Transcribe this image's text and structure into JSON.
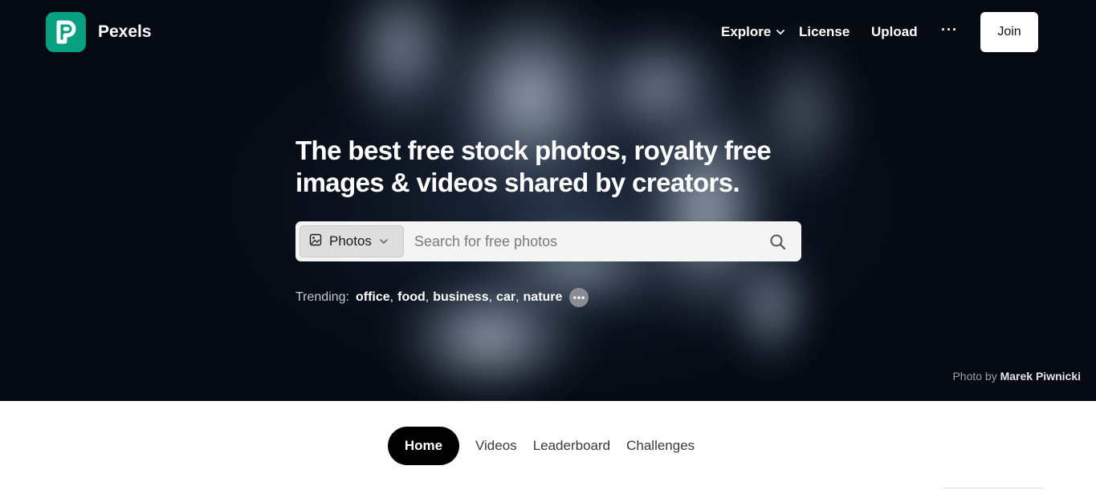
{
  "brand": {
    "name": "Pexels",
    "logo_color": "#07a081"
  },
  "nav": {
    "explore": "Explore",
    "license": "License",
    "upload": "Upload",
    "more": "···",
    "join": "Join"
  },
  "hero": {
    "headline_line1": "The best free stock photos, royalty free",
    "headline_line2": "images & videos shared by creators.",
    "search": {
      "type_label": "Photos",
      "placeholder": "Search for free photos"
    },
    "trending": {
      "label": "Trending:",
      "items": [
        "office",
        "food",
        "business",
        "car",
        "nature"
      ],
      "more": "•••"
    },
    "credit": {
      "prefix": "Photo by",
      "author": "Marek Piwnicki"
    }
  },
  "tabs": [
    "Home",
    "Videos",
    "Leaderboard",
    "Challenges"
  ],
  "active_tab": "Home"
}
